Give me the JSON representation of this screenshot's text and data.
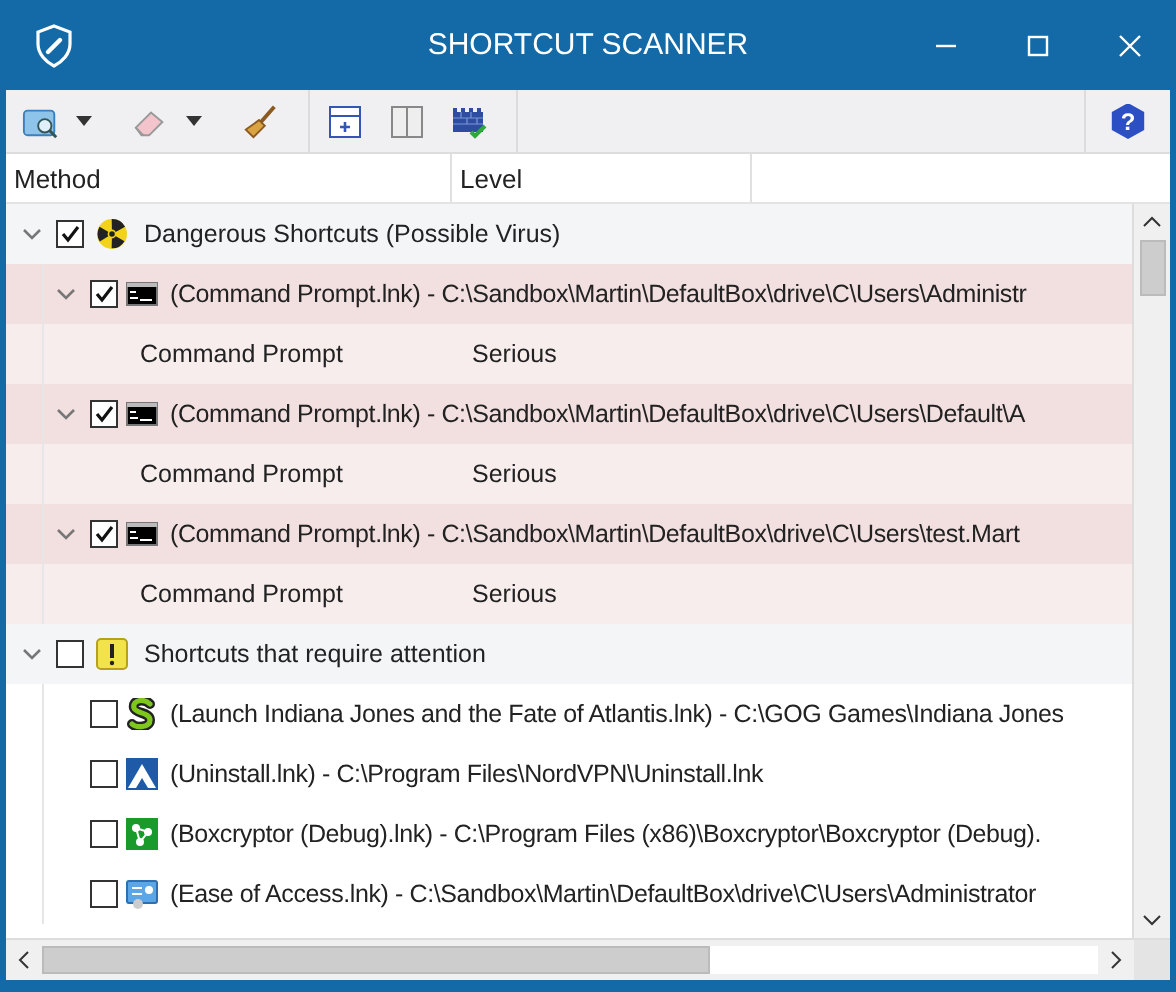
{
  "window": {
    "title": "SHORTCUT SCANNER"
  },
  "help": {
    "label": "?"
  },
  "columns": [
    "Method",
    "Level"
  ],
  "groups": [
    {
      "label": "Dangerous Shortcuts (Possible Virus)",
      "kind": "danger",
      "expanded": true,
      "checked": true,
      "items": [
        {
          "kind": "cmd",
          "label": "(Command Prompt.lnk) - C:\\Sandbox\\Martin\\DefaultBox\\drive\\C\\Users\\Administr",
          "checked": true,
          "expanded": true,
          "method": "Command Prompt",
          "level": "Serious"
        },
        {
          "kind": "cmd",
          "label": "(Command Prompt.lnk) - C:\\Sandbox\\Martin\\DefaultBox\\drive\\C\\Users\\Default\\A",
          "checked": true,
          "expanded": true,
          "method": "Command Prompt",
          "level": "Serious"
        },
        {
          "kind": "cmd",
          "label": "(Command Prompt.lnk) - C:\\Sandbox\\Martin\\DefaultBox\\drive\\C\\Users\\test.Mart",
          "checked": true,
          "expanded": true,
          "method": "Command Prompt",
          "level": "Serious"
        }
      ]
    },
    {
      "label": "Shortcuts that require attention",
      "kind": "warning",
      "expanded": true,
      "checked": false,
      "items": [
        {
          "kind": "game",
          "label": "(Launch Indiana Jones and the Fate of Atlantis.lnk) - C:\\GOG Games\\Indiana Jones",
          "checked": false
        },
        {
          "kind": "vpn",
          "label": "(Uninstall.lnk) - C:\\Program Files\\NordVPN\\Uninstall.lnk",
          "checked": false
        },
        {
          "kind": "boxcryptor",
          "label": "(Boxcryptor (Debug).lnk) - C:\\Program Files (x86)\\Boxcryptor\\Boxcryptor (Debug).",
          "checked": false
        },
        {
          "kind": "access",
          "label": "(Ease of Access.lnk) - C:\\Sandbox\\Martin\\DefaultBox\\drive\\C\\Users\\Administrator",
          "checked": false
        }
      ]
    }
  ]
}
